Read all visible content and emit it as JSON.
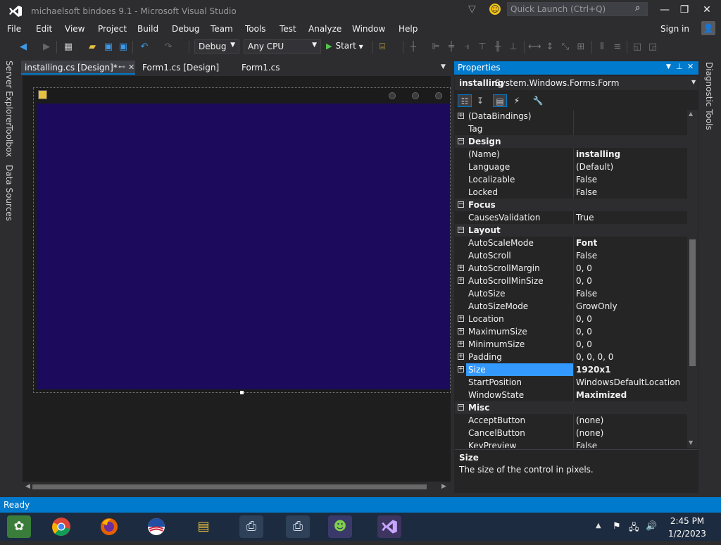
{
  "window": {
    "title": "michaelsoft bindoes 9.1 - Microsoft Visual Studio",
    "quick_launch_placeholder": "Quick Launch (Ctrl+Q)",
    "sign_in": "Sign in"
  },
  "menu": [
    "File",
    "Edit",
    "View",
    "Project",
    "Build",
    "Debug",
    "Team",
    "Tools",
    "Test",
    "Analyze",
    "Window",
    "Help"
  ],
  "toolbar": {
    "configuration": "Debug",
    "platform": "Any CPU",
    "start_label": "Start"
  },
  "left_tabs": [
    "Server Explorer",
    "Toolbox",
    "Data Sources"
  ],
  "right_tabs": [
    "Diagnostic Tools"
  ],
  "doc_tabs": [
    {
      "label": "installing.cs [Design]*",
      "active": true
    },
    {
      "label": "Form1.cs [Design]",
      "active": false
    },
    {
      "label": "Form1.cs",
      "active": false
    }
  ],
  "designer": {
    "form_color": "#1c0a5c"
  },
  "properties": {
    "panel_title": "Properties",
    "object_name": "installing",
    "object_type": "System.Windows.Forms.Form",
    "rows": [
      {
        "kind": "prop",
        "expand": true,
        "name": "(DataBindings)",
        "value": ""
      },
      {
        "kind": "prop",
        "expand": false,
        "name": "Tag",
        "value": ""
      },
      {
        "kind": "cat",
        "name": "Design"
      },
      {
        "kind": "prop",
        "expand": false,
        "name": "(Name)",
        "value": "installing",
        "bold": true
      },
      {
        "kind": "prop",
        "expand": false,
        "name": "Language",
        "value": "(Default)"
      },
      {
        "kind": "prop",
        "expand": false,
        "name": "Localizable",
        "value": "False"
      },
      {
        "kind": "prop",
        "expand": false,
        "name": "Locked",
        "value": "False"
      },
      {
        "kind": "cat",
        "name": "Focus"
      },
      {
        "kind": "prop",
        "expand": false,
        "name": "CausesValidation",
        "value": "True"
      },
      {
        "kind": "cat",
        "name": "Layout"
      },
      {
        "kind": "prop",
        "expand": false,
        "name": "AutoScaleMode",
        "value": "Font",
        "bold": true
      },
      {
        "kind": "prop",
        "expand": false,
        "name": "AutoScroll",
        "value": "False"
      },
      {
        "kind": "prop",
        "expand": true,
        "name": "AutoScrollMargin",
        "value": "0, 0"
      },
      {
        "kind": "prop",
        "expand": true,
        "name": "AutoScrollMinSize",
        "value": "0, 0"
      },
      {
        "kind": "prop",
        "expand": false,
        "name": "AutoSize",
        "value": "False"
      },
      {
        "kind": "prop",
        "expand": false,
        "name": "AutoSizeMode",
        "value": "GrowOnly"
      },
      {
        "kind": "prop",
        "expand": true,
        "name": "Location",
        "value": "0, 0"
      },
      {
        "kind": "prop",
        "expand": true,
        "name": "MaximumSize",
        "value": "0, 0"
      },
      {
        "kind": "prop",
        "expand": true,
        "name": "MinimumSize",
        "value": "0, 0"
      },
      {
        "kind": "prop",
        "expand": true,
        "name": "Padding",
        "value": "0, 0, 0, 0"
      },
      {
        "kind": "prop",
        "expand": true,
        "name": "Size",
        "value": "1920x1",
        "bold": true,
        "selected": true
      },
      {
        "kind": "prop",
        "expand": false,
        "name": "StartPosition",
        "value": "WindowsDefaultLocation"
      },
      {
        "kind": "prop",
        "expand": false,
        "name": "WindowState",
        "value": "Maximized",
        "bold": true
      },
      {
        "kind": "cat",
        "name": "Misc"
      },
      {
        "kind": "prop",
        "expand": false,
        "name": "AcceptButton",
        "value": "(none)"
      },
      {
        "kind": "prop",
        "expand": false,
        "name": "CancelButton",
        "value": "(none)"
      },
      {
        "kind": "prop",
        "expand": false,
        "name": "KeyPreview",
        "value": "False"
      }
    ],
    "description_title": "Size",
    "description_text": "The size of the control in pixels."
  },
  "status": {
    "text": "Ready"
  },
  "taskbar": {
    "apps": [
      "picasa-icon",
      "chrome-icon",
      "firefox-icon",
      "obama-logo-icon",
      "file-explorer-icon",
      "installer-icon",
      "setup-icon",
      "messenger-icon",
      "visual-studio-icon"
    ],
    "time": "2:45 PM",
    "date": "1/2/2023"
  },
  "colors": {
    "accent": "#007acc",
    "selection": "#3399ff",
    "ide_background": "#2d2d30"
  }
}
